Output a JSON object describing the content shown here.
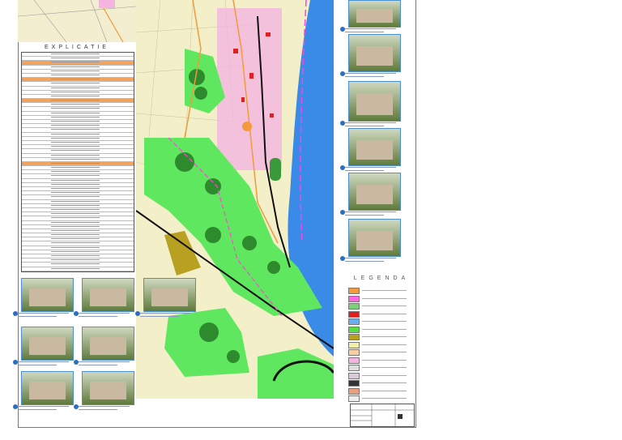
{
  "explanation": {
    "title": "EXPLICATIE"
  },
  "legend": {
    "title": "LEGENDA",
    "colors": [
      "#f39a3a",
      "#ff66dd",
      "#7bd07b",
      "#e02020",
      "#6aaef0",
      "#55dd44",
      "#b8a020",
      "#efeeaa",
      "#f5cf9f",
      "#f3b5e0",
      "#dddddd",
      "#d9c9d9",
      "#333333",
      "#e8a080",
      "#eeeeee"
    ]
  },
  "map": {
    "colors": {
      "green": "#5fe85f",
      "river": "#3a8ae8",
      "built": "#f2efc9",
      "pink": "#f3b5e0",
      "road": "#f39a3a"
    }
  }
}
